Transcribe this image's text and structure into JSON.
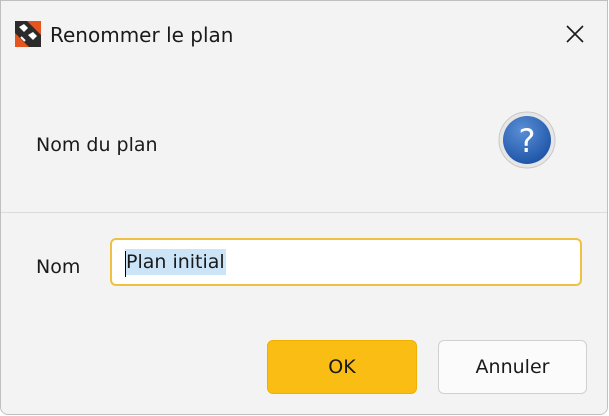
{
  "window": {
    "title": "Renommer le plan",
    "close_icon": "close-icon",
    "app_icon": "application-logo-icon"
  },
  "header": {
    "text": "Nom du plan",
    "icon": "help-question-icon"
  },
  "form": {
    "name_label": "Nom",
    "name_value": "Plan initial"
  },
  "buttons": {
    "ok_label": "OK",
    "cancel_label": "Annuler"
  },
  "colors": {
    "accent": "#f9bd13",
    "input_focus_border": "#f0c040",
    "selection": "#cce4f7",
    "help_icon": "#2e67b8"
  }
}
